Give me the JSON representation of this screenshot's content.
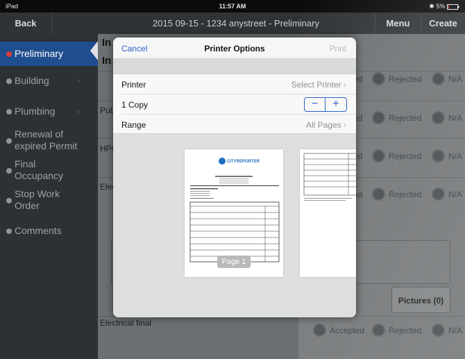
{
  "status_bar": {
    "device": "iPad",
    "time": "11:57 AM",
    "battery": "5%"
  },
  "nav": {
    "back": "Back",
    "title": "2015 09-15 - 1234 anystreet - Preliminary",
    "menu": "Menu",
    "create": "Create"
  },
  "sidebar": {
    "items": [
      {
        "label": "Preliminary",
        "active": true
      },
      {
        "label": "Building"
      },
      {
        "label": "Plumbing"
      },
      {
        "label_line1": "Renewal of",
        "label_line2": "expired Permit"
      },
      {
        "label_line1": "Final",
        "label_line2": "Occupancy"
      },
      {
        "label_line1": "Stop Work",
        "label_line2": "Order"
      },
      {
        "label": "Comments"
      }
    ]
  },
  "content": {
    "header_lines": [
      "In",
      "In"
    ],
    "rows": [
      {
        "label": "",
        "options": [
          "ed",
          "Rejected",
          "N/A"
        ]
      },
      {
        "label": "Pub",
        "options": [
          "ed",
          "Rejected",
          "N/A"
        ]
      },
      {
        "label": "HPC",
        "options": [
          "ed",
          "Rejected",
          "N/A"
        ]
      },
      {
        "label": "Elec",
        "options": [
          "ed",
          "Rejected",
          "N/A"
        ]
      },
      {
        "label": "Electrical final",
        "options": [
          "Accepted",
          "Rejected",
          "N/A"
        ]
      }
    ],
    "pictures_button": "Pictures (0)"
  },
  "printer_dialog": {
    "cancel": "Cancel",
    "title": "Printer Options",
    "print": "Print",
    "printer_label": "Printer",
    "printer_value": "Select Printer",
    "copies_label": "1 Copy",
    "range_label": "Range",
    "range_value": "All Pages",
    "page_label": "Page 1",
    "preview_logo": "CITYREPORTER"
  },
  "colors": {
    "accent": "#2a62c8",
    "sidebar_active": "#1f4e8e",
    "active_dot": "#d83a3a"
  }
}
